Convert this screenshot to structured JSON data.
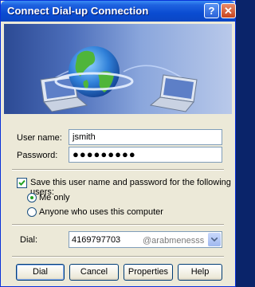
{
  "window": {
    "title": "Connect Dial-up Connection",
    "help_glyph": "?",
    "close_glyph": "✕"
  },
  "form": {
    "username_label": "User name:",
    "username_value": "jsmith",
    "password_label": "Password:",
    "password_value": "●●●●●●●●●",
    "save_label": "Save this user name and password for the following users:",
    "save_checked": true,
    "radio_me_only": "Me only",
    "radio_anyone": "Anyone who uses this computer",
    "selected_radio": "me_only",
    "dial_label": "Dial:",
    "dial_value": "4169797703",
    "watermark": "@arabmenesss"
  },
  "buttons": {
    "dial": "Dial",
    "cancel": "Cancel",
    "properties": "Properties",
    "help": "Help"
  },
  "icons": [
    "help-icon",
    "close-icon",
    "globe-network-icon",
    "checkmark-icon",
    "chevron-down-icon"
  ],
  "colors": {
    "titlebar": "#0a4cd1",
    "window_bg": "#ece9d8",
    "banner_dark": "#2c4a94",
    "radio_dot": "#21a121"
  }
}
